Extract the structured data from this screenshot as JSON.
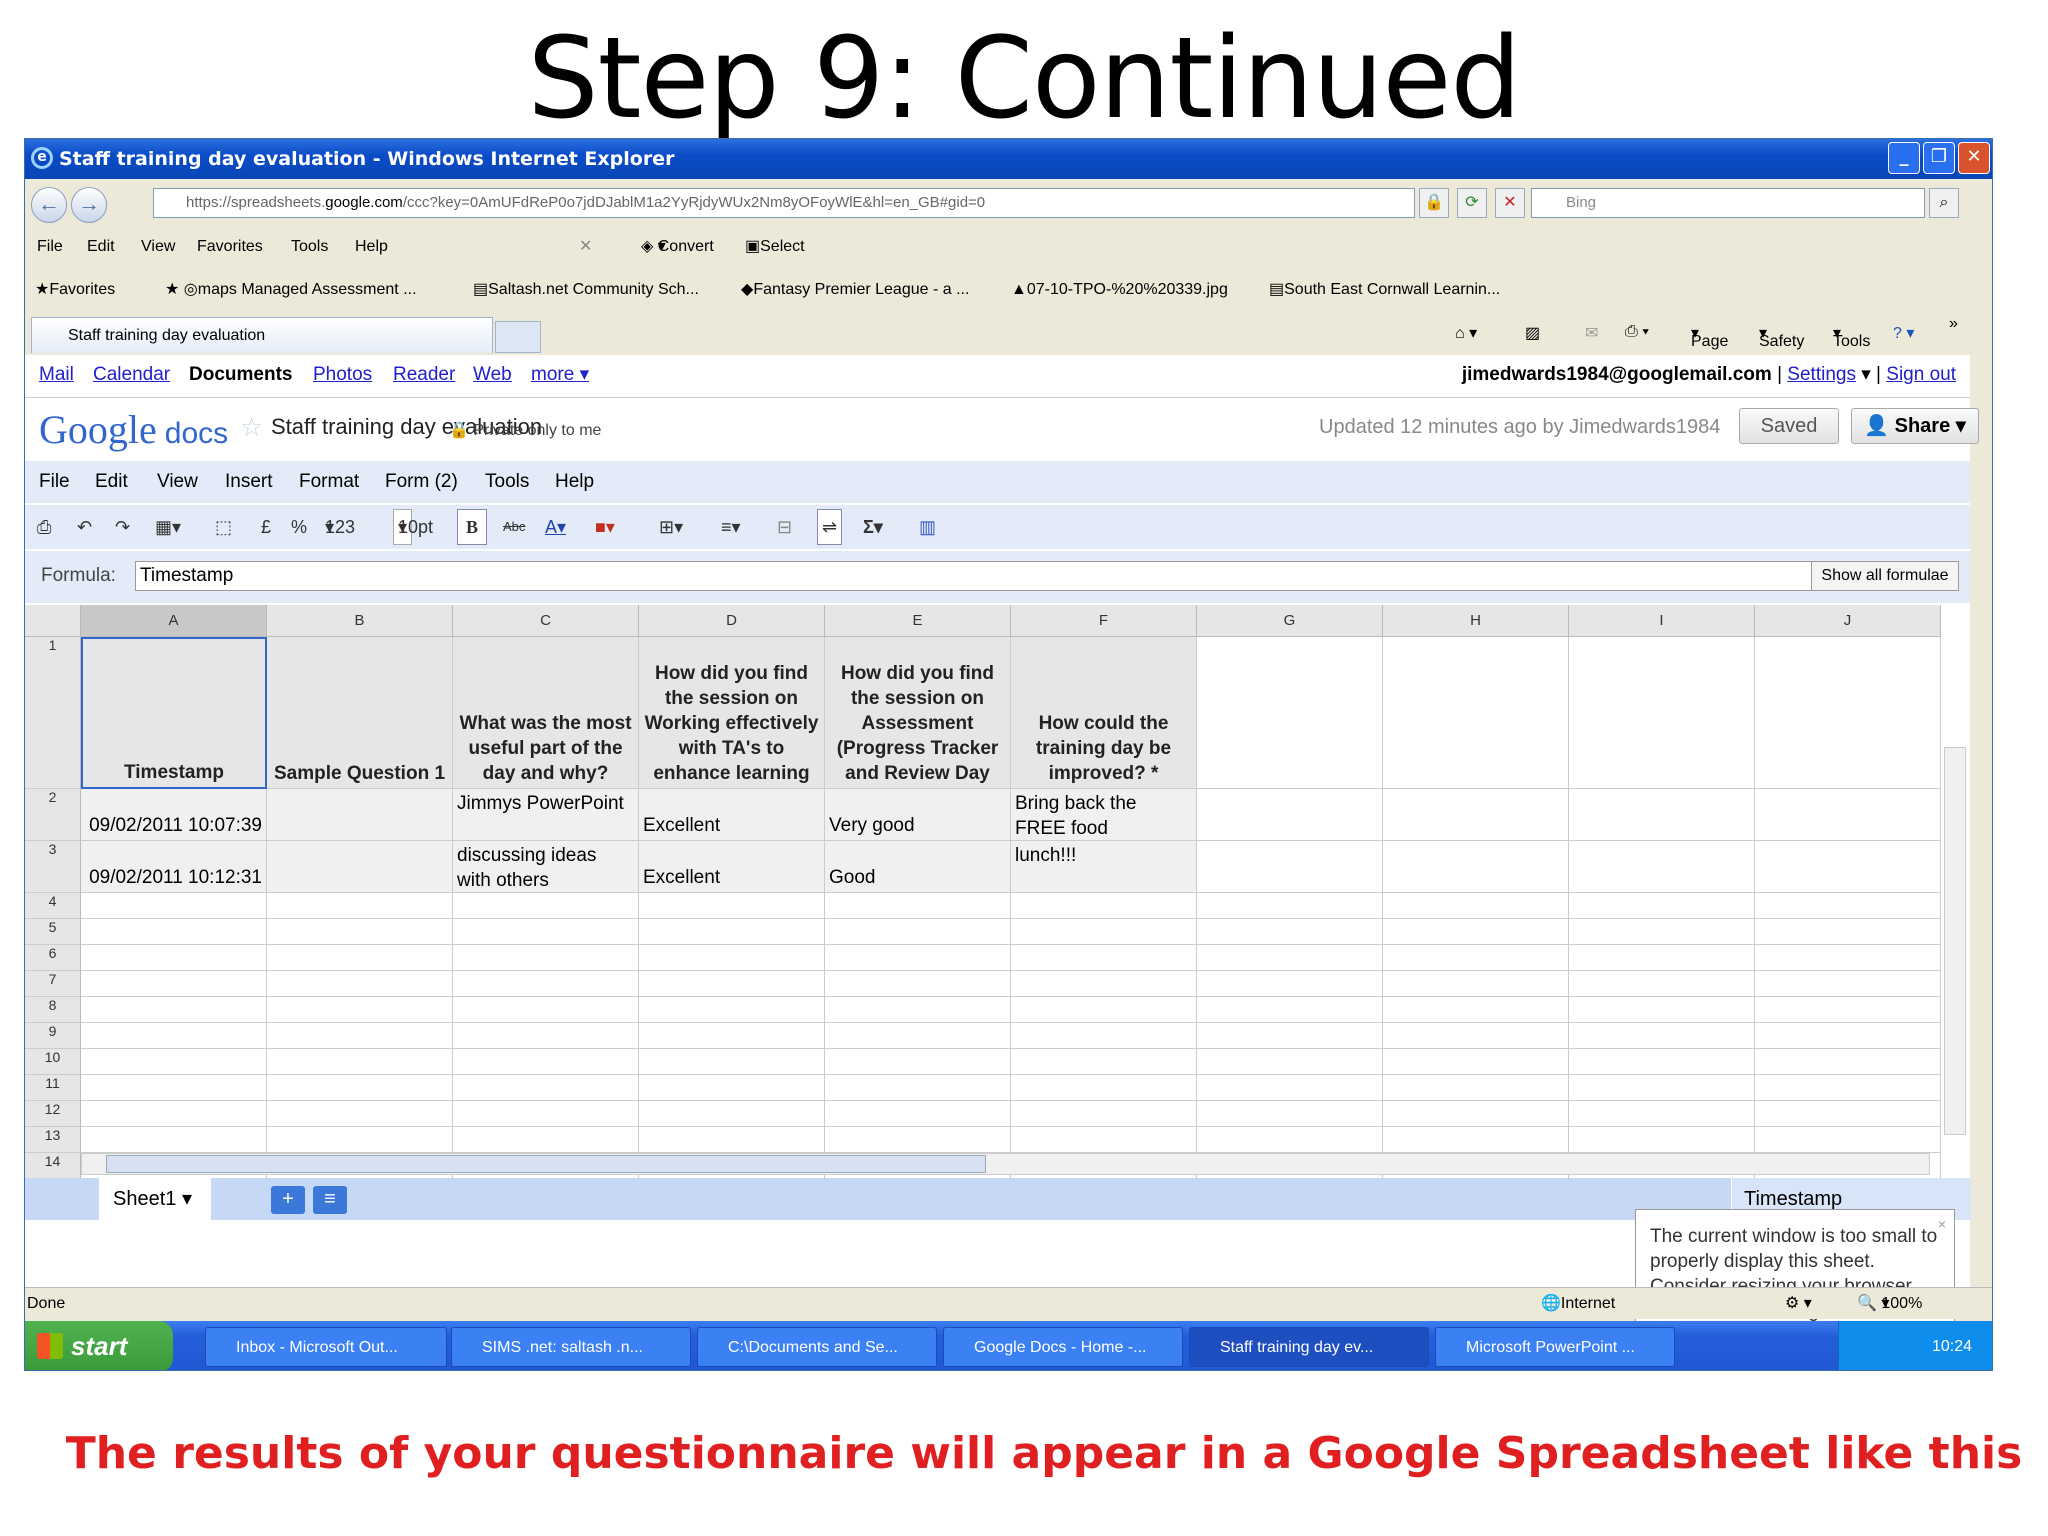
{
  "slide": {
    "title": "Step 9: Continued",
    "caption": "The results of your questionnaire will appear in a Google Spreadsheet like this"
  },
  "window": {
    "title": "Staff training day evaluation - Windows Internet Explorer",
    "url_prefix": "https://spreadsheets.",
    "url_domain": "google.com",
    "url_rest": "/ccc?key=0AmUFdReP0o7jdDJablM1a2YyRjdyWUx2Nm8yOFoyWlE&hl=en_GB#gid=0",
    "search_placeholder": "Bing",
    "menu": [
      "File",
      "Edit",
      "View",
      "Favorites",
      "Tools",
      "Help"
    ],
    "convert": "Convert",
    "select": "Select",
    "favorites": {
      "label": "Favorites",
      "items": [
        "maps Managed Assessment ...",
        "Saltash.net Community Sch...",
        "Fantasy Premier League - a ...",
        "07-10-TPO-%20%20339.jpg",
        "South East Cornwall Learnin..."
      ]
    },
    "tab": "Staff training day evaluation",
    "commands": [
      "Page",
      "Safety",
      "Tools"
    ]
  },
  "google_bar": {
    "links": [
      "Mail",
      "Calendar",
      "Documents",
      "Photos",
      "Reader",
      "Web",
      "more ▾"
    ],
    "email": "jimedwards1984@googlemail.com",
    "settings": "Settings",
    "signout": "Sign out"
  },
  "doc": {
    "logo_google": "Google",
    "logo_docs": "docs",
    "title": "Staff training day evaluation",
    "private": "Private only to me",
    "updated": "Updated 12 minutes ago by Jimedwards1984",
    "saved": "Saved",
    "share": "Share",
    "menu": [
      "File",
      "Edit",
      "View",
      "Insert",
      "Format",
      "Form (2)",
      "Tools",
      "Help"
    ],
    "toolbar": {
      "currency": "£",
      "percent": "%",
      "number": "123",
      "fontsize": "10pt",
      "bold": "B",
      "strike": "Abc"
    },
    "formula_label": "Formula:",
    "formula_value": "Timestamp",
    "show_formulae": "Show all formulae"
  },
  "sheet": {
    "columns": [
      "A",
      "B",
      "C",
      "D",
      "E",
      "F",
      "G",
      "H",
      "I",
      "J"
    ],
    "rows": [
      "1",
      "2",
      "3",
      "4",
      "5",
      "6",
      "7",
      "8",
      "9",
      "10",
      "11",
      "12",
      "13",
      "14"
    ],
    "headers": [
      "Timestamp",
      "Sample Question 1",
      "What was the most useful part of the day and why?",
      "How did you find the session on Working effectively with TA's to enhance learning",
      "How did you find the session on Assessment (Progress Tracker and Review Day",
      "How could the training day be improved? *"
    ],
    "data": [
      [
        "09/02/2011 10:07:39",
        "",
        "Jimmys PowerPoint",
        "Excellent",
        "Very good",
        "Bring back the FREE food"
      ],
      [
        "09/02/2011 10:12:31",
        "",
        "discussing ideas with others",
        "Excellent",
        "Good",
        "lunch!!!"
      ]
    ],
    "tab_name": "Sheet1",
    "footer_value": "Timestamp",
    "popup": "The current window is too small to properly display this sheet. Consider resizing your browser window or switching to List View."
  },
  "status": {
    "left": "Done",
    "zone": "Internet",
    "zoom": "100%"
  },
  "taskbar": {
    "start": "start",
    "tasks": [
      "Inbox - Microsoft Out...",
      "SIMS .net: saltash .n...",
      "C:\\Documents and Se...",
      "Google Docs - Home -...",
      "Staff training day ev...",
      "Microsoft PowerPoint ..."
    ],
    "time": "10:24"
  }
}
